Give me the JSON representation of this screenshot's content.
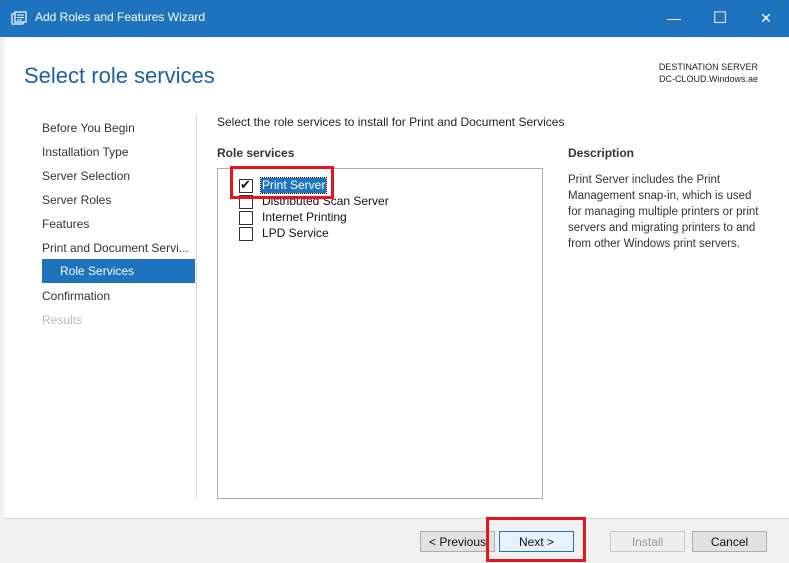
{
  "window": {
    "title": "Add Roles and Features Wizard",
    "controls": {
      "minimize": "—",
      "maximize": "☐",
      "close": "✕"
    }
  },
  "page": {
    "heading": "Select role services",
    "destination_label": "DESTINATION SERVER",
    "destination_server": "DC-CLOUD.Windows.ae"
  },
  "nav": {
    "items": [
      {
        "label": "Before You Begin",
        "state": "normal"
      },
      {
        "label": "Installation Type",
        "state": "normal"
      },
      {
        "label": "Server Selection",
        "state": "normal"
      },
      {
        "label": "Server Roles",
        "state": "normal"
      },
      {
        "label": "Features",
        "state": "normal"
      },
      {
        "label": "Print and Document Servi...",
        "state": "normal"
      },
      {
        "label": "Role Services",
        "state": "active"
      },
      {
        "label": "Confirmation",
        "state": "normal"
      },
      {
        "label": "Results",
        "state": "disabled"
      }
    ]
  },
  "main": {
    "instruction": "Select the role services to install for Print and Document Services",
    "role_services_label": "Role services",
    "role_services": [
      {
        "label": "Print Server",
        "checked": true,
        "selected": true
      },
      {
        "label": "Distributed Scan Server",
        "checked": false,
        "selected": false
      },
      {
        "label": "Internet Printing",
        "checked": false,
        "selected": false
      },
      {
        "label": "LPD Service",
        "checked": false,
        "selected": false
      }
    ],
    "description_label": "Description",
    "description": "Print Server includes the Print Management snap-in, which is used for managing multiple printers or print servers and migrating printers to and from other Windows print servers."
  },
  "footer": {
    "previous": "< Previous",
    "next": "Next >",
    "install": "Install",
    "cancel": "Cancel"
  },
  "colors": {
    "accent": "#1e73be",
    "highlight": "#e3161e"
  }
}
